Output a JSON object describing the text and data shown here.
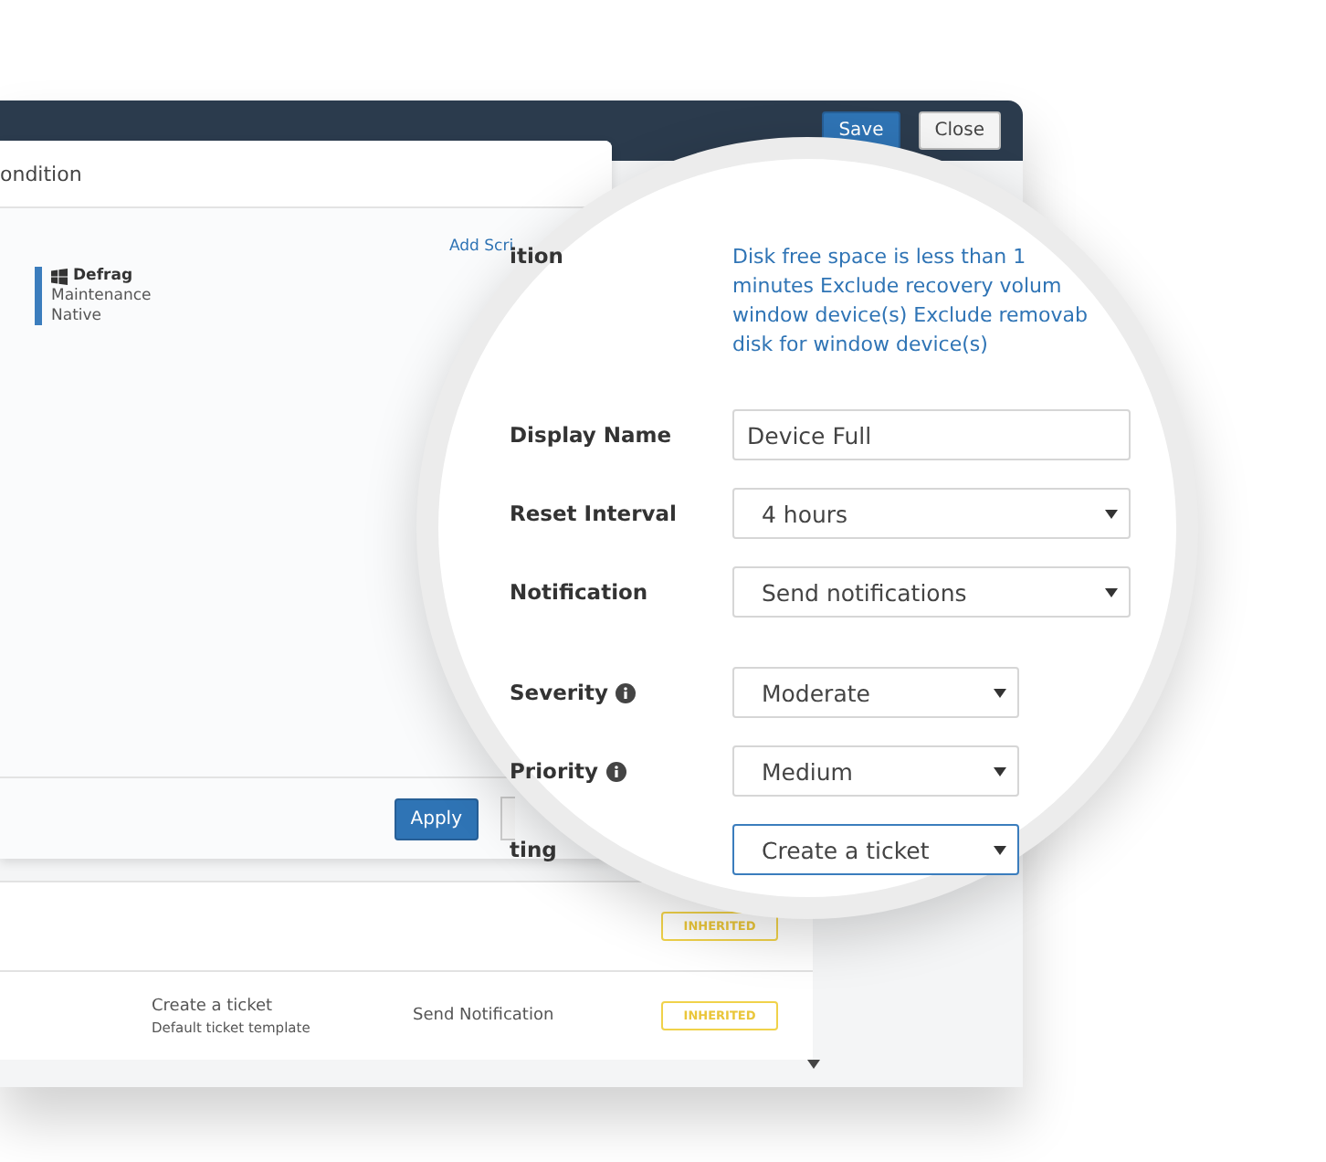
{
  "window": {
    "buttons": [
      {
        "label": "Save",
        "kind": "primary"
      },
      {
        "label": "Close",
        "kind": "default"
      }
    ]
  },
  "dialog": {
    "title": "ondition",
    "link": "Add Scri",
    "script": {
      "name": "Defrag",
      "category": "Maintenance",
      "type": "Native"
    },
    "buttons": [
      {
        "label": "Apply",
        "kind": "primary"
      }
    ]
  },
  "magnifier": {
    "condition_label": "ition",
    "condition_lines": [
      "Disk free space is less than 1",
      "minutes Exclude recovery volum",
      "window device(s) Exclude removab",
      "disk for window device(s)"
    ],
    "fields": [
      {
        "label": "Display Name",
        "kind": "text",
        "value": "Device Full",
        "info": false,
        "focused": false,
        "wide": true
      },
      {
        "label": "Reset Interval",
        "kind": "select",
        "value": "4 hours",
        "info": false,
        "focused": false,
        "wide": true
      },
      {
        "label": "Notification",
        "kind": "select",
        "value": "Send notifications",
        "info": false,
        "focused": false,
        "wide": true
      },
      {
        "label": "Severity",
        "kind": "select",
        "value": "Moderate",
        "info": true,
        "focused": false,
        "wide": false
      },
      {
        "label": "Priority",
        "kind": "select",
        "value": "Medium",
        "info": true,
        "focused": false,
        "wide": false
      },
      {
        "label": "ting",
        "kind": "select",
        "value": "Create a ticket",
        "info": false,
        "focused": true,
        "wide": false
      }
    ]
  },
  "rows": [
    {
      "badge": "INHERITED"
    },
    {
      "ticket": "Create a ticket",
      "template": "Default ticket template",
      "notification": "Send Notification",
      "badge": "INHERITED"
    }
  ]
}
